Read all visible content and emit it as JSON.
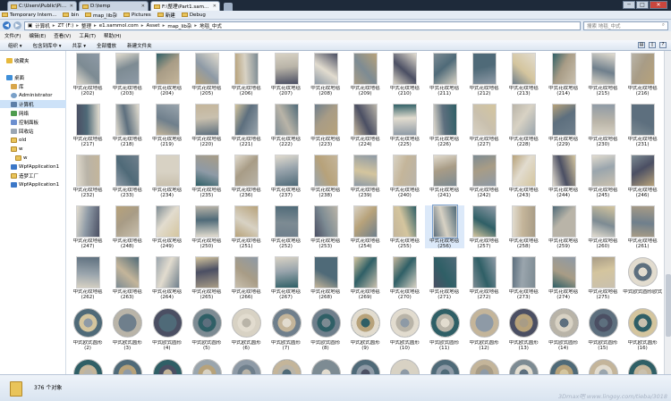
{
  "tabs": [
    {
      "label": "C:\\Users\\Public\\Pictures",
      "active": false
    },
    {
      "label": "D:\\temp",
      "active": false
    },
    {
      "label": "F:\\整理\\Part1.sammol.com\\As...",
      "active": true
    }
  ],
  "window_buttons": [
    "─",
    "□",
    "✕"
  ],
  "bookmarks": [
    "Temporary Intern...",
    "bin",
    "map_lib杂",
    "Pictures",
    "新建",
    "Debug"
  ],
  "address": {
    "crumbs": [
      "计算机",
      "ZT (F:)",
      "整理",
      "e1.sammol.com",
      "Asset",
      "map_lib杂",
      "地毯_中式"
    ],
    "search_placeholder": "搜索 地毯_中式"
  },
  "menu": [
    "文件(F)",
    "编辑(E)",
    "查看(V)",
    "工具(T)",
    "帮助(H)"
  ],
  "toolbar": [
    "组织 ▾",
    "包含到库中 ▾",
    "共享 ▾",
    "全部播放",
    "新建文件夹"
  ],
  "sidebar": [
    {
      "label": "收藏夹",
      "icon": "star-icon",
      "indent": 0,
      "selected": false
    },
    {
      "label": "桌面",
      "icon": "desktop-icon",
      "indent": 0,
      "selected": false
    },
    {
      "label": "库",
      "icon": "library-icon",
      "indent": 1,
      "selected": false
    },
    {
      "label": "Administrator",
      "icon": "user-icon",
      "indent": 1,
      "selected": false
    },
    {
      "label": "计算机",
      "icon": "computer-icon",
      "indent": 1,
      "selected": true
    },
    {
      "label": "网络",
      "icon": "network-icon",
      "indent": 1,
      "selected": false
    },
    {
      "label": "控制面板",
      "icon": "control-panel-icon",
      "indent": 1,
      "selected": false
    },
    {
      "label": "回收站",
      "icon": "recycle-bin-icon",
      "indent": 1,
      "selected": false
    },
    {
      "label": "old",
      "icon": "folder-icon",
      "indent": 1,
      "selected": false
    },
    {
      "label": "w",
      "icon": "folder-icon",
      "indent": 1,
      "selected": false
    },
    {
      "label": "w",
      "icon": "folder-icon",
      "indent": 2,
      "selected": false
    },
    {
      "label": "WpfApplication1",
      "icon": "app-icon",
      "indent": 1,
      "selected": false
    },
    {
      "label": "造梦工厂",
      "icon": "folder-icon",
      "indent": 1,
      "selected": false
    },
    {
      "label": "WpfApplication1",
      "icon": "app-icon",
      "indent": 1,
      "selected": false
    }
  ],
  "files": {
    "rect_label": "中式花纹地毯",
    "rect_rows": [
      [
        "(202)",
        "(203)",
        "(204)",
        "(205)",
        "(206)",
        "(207)",
        "(208)",
        "(209)",
        "(210)",
        "(211)",
        "(212)",
        "(213)",
        "(214)",
        "(215)",
        "(216)"
      ],
      [
        "(217)",
        "(218)",
        "(219)",
        "(220)",
        "(221)",
        "(222)",
        "(223)",
        "(224)",
        "(225)",
        "(226)",
        "(227)",
        "(228)",
        "(229)",
        "(230)",
        "(231)"
      ],
      [
        "(232)",
        "(233)",
        "(234)",
        "(235)",
        "(236)",
        "(237)",
        "(238)",
        "(239)",
        "(240)",
        "(241)",
        "(242)",
        "(243)",
        "(244)",
        "(245)",
        "(246)"
      ],
      [
        "(247)",
        "(248)",
        "(249)",
        "(250)",
        "(251)",
        "(252)",
        "(253)",
        "(254)",
        "(255)",
        "(256)",
        "(257)",
        "(258)",
        "(259)",
        "(260)",
        "(261)"
      ],
      [
        "(262)",
        "(263)",
        "(264)",
        "(265)",
        "(266)",
        "(267)",
        "(268)",
        "(269)",
        "(270)",
        "(271)",
        "(272)",
        "(273)",
        "(274)",
        "(275)"
      ]
    ],
    "round_label_a": "中式欧式圆形",
    "round_label_b": "欧式地毯",
    "round_first": "中式欧式圆形欧式地毯 (1)",
    "round_nums": [
      "(2)",
      "(3)",
      "(4)",
      "(5)",
      "(6)",
      "(7)",
      "(8)",
      "(9)",
      "(10)",
      "(11)",
      "(12)",
      "(13)",
      "(14)",
      "(15)",
      "(16)"
    ],
    "selected_num": "(256)"
  },
  "status": {
    "count_text": "376 个对象"
  },
  "watermark": "3Dmax吧 www.lingoy.com/tieba/3018",
  "colors": {
    "rug_palette": [
      "#b9b4a8",
      "#8e9aa6",
      "#d8d2c4",
      "#6f7f8c",
      "#c4b59a",
      "#4f6a78",
      "#a89c86",
      "#e2dccf",
      "#7d8b93",
      "#2f5f66",
      "#b7a27a",
      "#9aa5ad",
      "#c9c0ae",
      "#5d6f7e",
      "#d4c59e",
      "#4b4f63"
    ]
  }
}
